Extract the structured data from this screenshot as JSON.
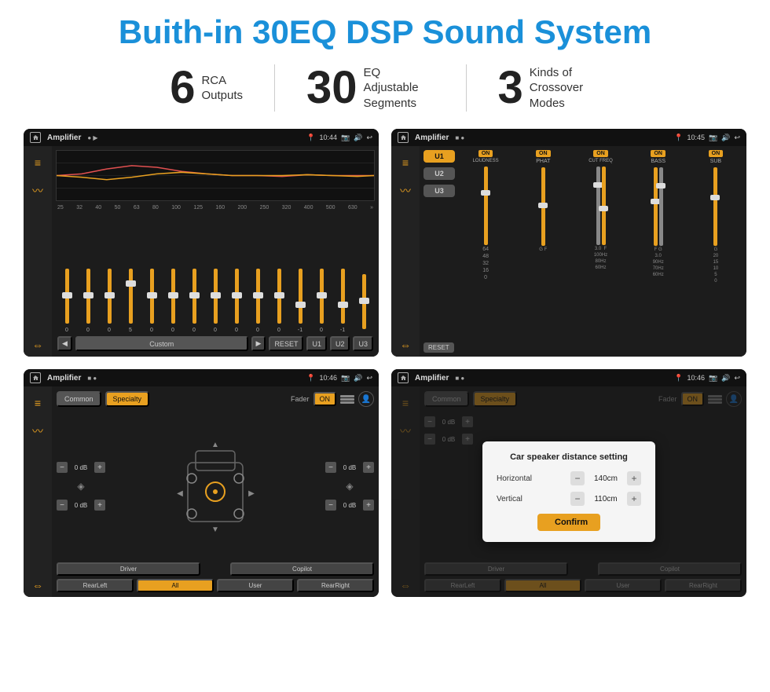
{
  "title": "Buith-in 30EQ DSP Sound System",
  "stats": [
    {
      "number": "6",
      "label": "RCA\nOutputs"
    },
    {
      "number": "30",
      "label": "EQ Adjustable\nSegments"
    },
    {
      "number": "3",
      "label": "Kinds of\nCrossover Modes"
    }
  ],
  "screens": [
    {
      "id": "eq-screen",
      "statusbar": {
        "appname": "Amplifier",
        "time": "10:44"
      },
      "type": "eq"
    },
    {
      "id": "crossover-screen",
      "statusbar": {
        "appname": "Amplifier",
        "time": "10:45"
      },
      "type": "crossover"
    },
    {
      "id": "fader-screen",
      "statusbar": {
        "appname": "Amplifier",
        "time": "10:46"
      },
      "type": "fader"
    },
    {
      "id": "dialog-screen",
      "statusbar": {
        "appname": "Amplifier",
        "time": "10:46"
      },
      "type": "dialog"
    }
  ],
  "eq": {
    "frequencies": [
      "25",
      "32",
      "40",
      "50",
      "63",
      "80",
      "100",
      "125",
      "160",
      "200",
      "250",
      "320",
      "400",
      "500",
      "630"
    ],
    "values": [
      "0",
      "0",
      "0",
      "5",
      "0",
      "0",
      "0",
      "0",
      "0",
      "0",
      "0",
      "-1",
      "0",
      "-1",
      ""
    ],
    "buttons": [
      "Custom",
      "RESET",
      "U1",
      "U2",
      "U3"
    ]
  },
  "crossover": {
    "units": [
      "U1",
      "U2",
      "U3"
    ],
    "panels": [
      {
        "on": true,
        "label": "LOUDNESS"
      },
      {
        "on": true,
        "label": "PHAT"
      },
      {
        "on": true,
        "label": "CUT FREQ"
      },
      {
        "on": true,
        "label": "BASS"
      },
      {
        "on": true,
        "label": "SUB"
      }
    ],
    "reset": "RESET"
  },
  "fader": {
    "tabs": [
      "Common",
      "Specialty"
    ],
    "activeTab": "Specialty",
    "faderLabel": "Fader",
    "faderOn": "ON",
    "volumes": [
      "0 dB",
      "0 dB",
      "0 dB",
      "0 dB"
    ],
    "positions": [
      "Driver",
      "RearLeft",
      "All",
      "Copilot",
      "RearRight",
      "User"
    ]
  },
  "dialog": {
    "title": "Car speaker distance setting",
    "horizontal_label": "Horizontal",
    "horizontal_value": "140cm",
    "vertical_label": "Vertical",
    "vertical_value": "110cm",
    "confirm_label": "Confirm",
    "fader": {
      "tabs": [
        "Common",
        "Specialty"
      ],
      "volumes": [
        "0 dB",
        "0 dB"
      ]
    }
  }
}
